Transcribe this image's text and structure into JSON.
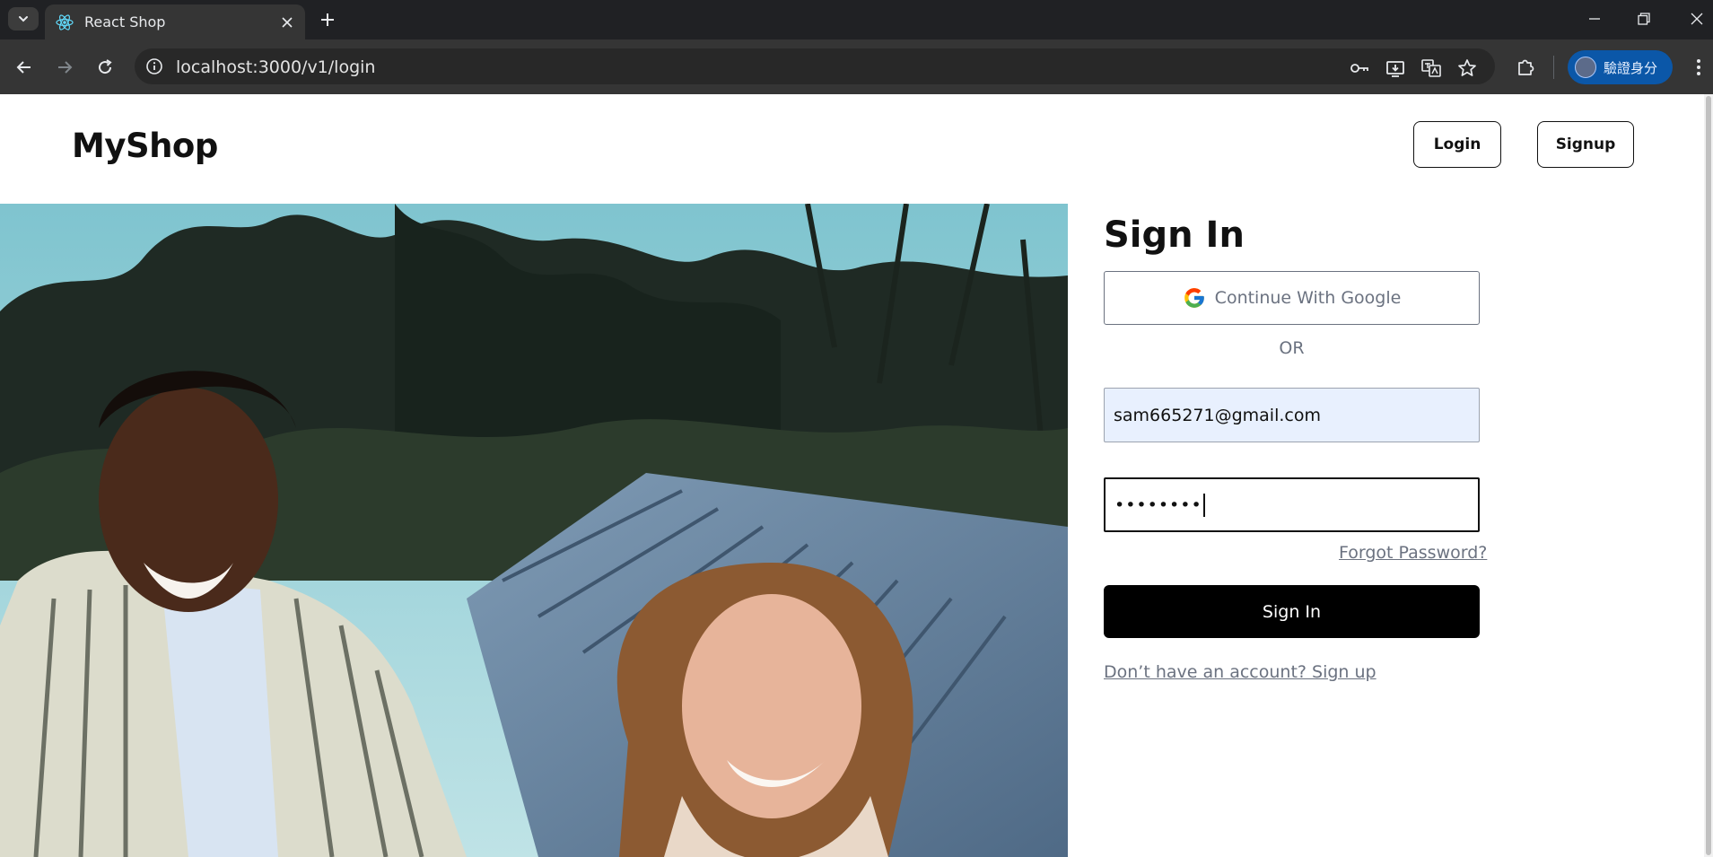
{
  "browser": {
    "tab_title": "React Shop",
    "url": "localhost:3000/v1/login",
    "profile_label": "驗證身分"
  },
  "header": {
    "brand": "MyShop",
    "login_label": "Login",
    "signup_label": "Signup"
  },
  "form": {
    "title": "Sign In",
    "google_label": "Continue With Google",
    "or_text": "OR",
    "email_value": "sam665271@gmail.com",
    "password_value": "••••••••",
    "forgot_label": "Forgot Password?",
    "submit_label": "Sign In",
    "signup_link": "Don’t have an account? Sign up"
  },
  "colors": {
    "chrome_dark": "#202124",
    "toolbar": "#353535",
    "profile_pill": "#0b57a8",
    "email_autofill_bg": "#e8f0fe",
    "primary_button": "#000000",
    "muted_text": "#6b7280"
  }
}
